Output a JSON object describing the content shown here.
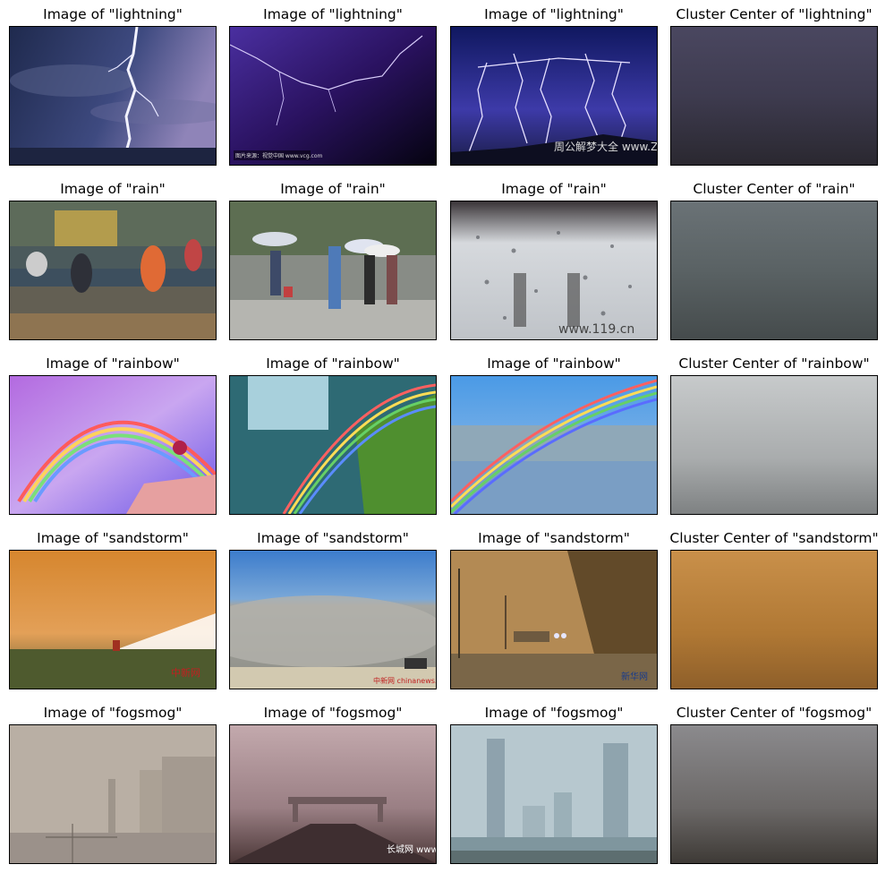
{
  "figure": {
    "rows": [
      {
        "category": "lightning",
        "titles": [
          "Image of \"lightning\"",
          "Image of \"lightning\"",
          "Image of \"lightning\"",
          "Cluster Center of \"lightning\""
        ],
        "panels": [
          "lightning-photo-1",
          "lightning-photo-2",
          "lightning-photo-3",
          "lightning-cluster-center"
        ],
        "watermarks": [
          "",
          "图片来源：视觉中国 www.vcg.com",
          "周公解梦大全 www.ZGjiemeng.com",
          ""
        ]
      },
      {
        "category": "rain",
        "titles": [
          "Image of \"rain\"",
          "Image of \"rain\"",
          "Image of \"rain\"",
          "Cluster Center of \"rain\""
        ],
        "panels": [
          "rain-photo-1",
          "rain-photo-2",
          "rain-photo-3",
          "rain-cluster-center"
        ],
        "watermarks": [
          "",
          "",
          "www.119.cn",
          ""
        ]
      },
      {
        "category": "rainbow",
        "titles": [
          "Image of \"rainbow\"",
          "Image of \"rainbow\"",
          "Image of \"rainbow\"",
          "Cluster Center of \"rainbow\""
        ],
        "panels": [
          "rainbow-photo-1",
          "rainbow-photo-2",
          "rainbow-photo-3",
          "rainbow-cluster-center"
        ],
        "watermarks": [
          "",
          "",
          "",
          ""
        ]
      },
      {
        "category": "sandstorm",
        "titles": [
          "Image of \"sandstorm\"",
          "Image of \"sandstorm\"",
          "Image of \"sandstorm\"",
          "Cluster Center of \"sandstorm\""
        ],
        "panels": [
          "sandstorm-photo-1",
          "sandstorm-photo-2",
          "sandstorm-photo-3",
          "sandstorm-cluster-center"
        ],
        "watermarks": [
          "中新网",
          "中新网 chinanews.com",
          "新华网",
          ""
        ]
      },
      {
        "category": "fogsmog",
        "titles": [
          "Image of \"fogsmog\"",
          "Image of \"fogsmog\"",
          "Image of \"fogsmog\"",
          "Cluster Center of \"fogsmog\""
        ],
        "panels": [
          "fogsmog-photo-1",
          "fogsmog-photo-2",
          "fogsmog-photo-3",
          "fogsmog-cluster-center"
        ],
        "watermarks": [
          "",
          "长城网 www.hebei.com.cn",
          "",
          ""
        ]
      }
    ]
  },
  "colors": {
    "lightning": [
      "#2d3360",
      "#1a1040",
      "#24236e",
      "#3e3b4c"
    ],
    "rain": [
      "#3d4a4a",
      "#8a8d89",
      "#c8ccd0",
      "#4f5758"
    ],
    "rainbow": [
      "#9d8de0",
      "#3a7d86",
      "#6e9fd8",
      "#a4a7a8"
    ],
    "sandstorm": [
      "#c78436",
      "#8c96a0",
      "#9d7a48",
      "#a5702e"
    ],
    "fogsmog": [
      "#b7ada3",
      "#8f7479",
      "#a9bcc4",
      "#5a5452"
    ]
  }
}
